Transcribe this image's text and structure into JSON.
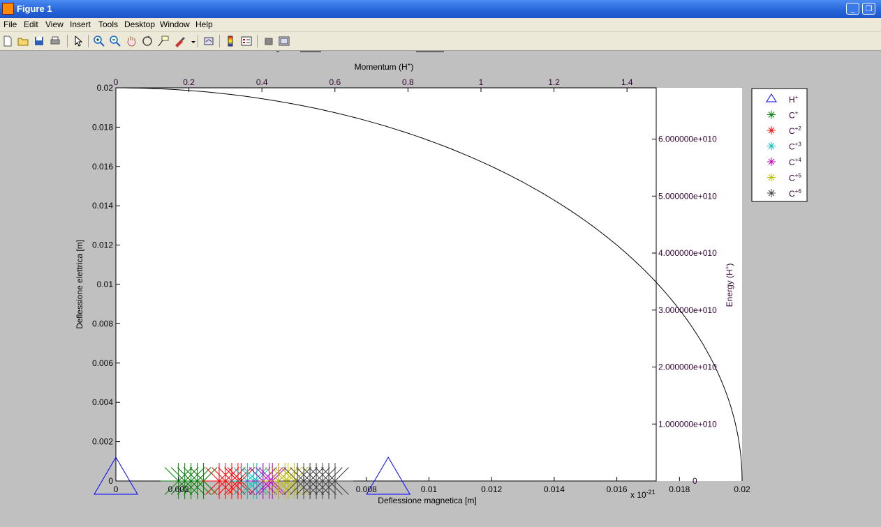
{
  "window": {
    "title": "Figure 1",
    "minimize_glyph": "_",
    "restore_glyph": "❐"
  },
  "menu": [
    "File",
    "Edit",
    "View",
    "Insert",
    "Tools",
    "Desktop",
    "Window",
    "Help"
  ],
  "toolbar_icons": [
    "new-figure-icon",
    "open-file-icon",
    "save-icon",
    "print-icon",
    "pointer-icon",
    "zoom-in-icon",
    "zoom-out-icon",
    "pan-hand-icon",
    "rotate-3d-icon",
    "data-cursor-icon",
    "brush-icon",
    "brush-dropdown-icon",
    "link-plot-icon",
    "colorbar-icon",
    "legend-icon",
    "hide-plot-tools-icon",
    "show-plot-tools-icon"
  ],
  "colors": {
    "hplus": "#0000ff",
    "c1": "#008000",
    "c2": "#ff0000",
    "c3": "#00bfbf",
    "c4": "#bf00bf",
    "c5": "#bfbf00",
    "c6": "#404040",
    "curve": "#000000"
  },
  "plot": {
    "x_label": "Deflessione magnetica [m]",
    "y_label": "Deflessione elettrica [m]",
    "top_label_main": "Momentum (H",
    "top_label_sup": "+",
    "top_label_end": ")",
    "right_label_main": "Energy (H",
    "right_label_sup": "+",
    "right_label_end": ")",
    "top_exponent_base": "x 10",
    "top_exponent_power": "-21",
    "x_ticks": [
      "0",
      "0.002",
      "",
      "",
      "0.008",
      "0.01",
      "0.012",
      "0.014",
      "0.016",
      "0.018",
      "0.02"
    ],
    "y_ticks": [
      "0",
      "0.002",
      "0.004",
      "0.006",
      "0.008",
      "0.01",
      "0.012",
      "0.014",
      "0.016",
      "0.018",
      "0.02"
    ],
    "top_ticks": [
      "0",
      "0.2",
      "0.4",
      "0.6",
      "0.8",
      "1",
      "1.2",
      "1.4"
    ],
    "right_ticks": [
      "0",
      "1.000000e+010",
      "2.000000e+010",
      "3.000000e+010",
      "4.000000e+010",
      "5.000000e+010",
      "6.000000e+010"
    ]
  },
  "chart_data": {
    "type": "scatter",
    "x_range": [
      0,
      0.02
    ],
    "y_range": [
      0,
      0.02
    ],
    "top_axis_range": [
      0,
      1.48
    ],
    "right_axis_range": [
      0,
      69000000000.0
    ],
    "curve": "quarter-ellipse from (0, 0.02) to (0.02, 0)",
    "hplus_points": [
      0,
      0.0087
    ],
    "c_series": [
      {
        "id": "c1",
        "x": [
          0.002,
          0.0022,
          0.0024,
          0.0026,
          0.0028
        ]
      },
      {
        "id": "c2",
        "x": [
          0.0033,
          0.0035,
          0.0037,
          0.0039,
          0.004
        ]
      },
      {
        "id": "c3",
        "x": [
          0.0042,
          0.0044,
          0.0045,
          0.0047
        ]
      },
      {
        "id": "c4",
        "x": [
          0.0047,
          0.0049,
          0.005,
          0.0052
        ]
      },
      {
        "id": "c5",
        "x": [
          0.0052,
          0.0054,
          0.0055,
          0.0057
        ]
      },
      {
        "id": "c6",
        "x": [
          0.0058,
          0.006,
          0.0062,
          0.0064,
          0.0066,
          0.0068,
          0.007
        ]
      }
    ]
  },
  "legend": [
    {
      "id": "hplus",
      "base": "H",
      "sup": "+",
      "marker": "triangle"
    },
    {
      "id": "c1",
      "base": "C",
      "sup": "+",
      "marker": "star"
    },
    {
      "id": "c2",
      "base": "C",
      "sup": "+2",
      "marker": "star"
    },
    {
      "id": "c3",
      "base": "C",
      "sup": "+3",
      "marker": "star"
    },
    {
      "id": "c4",
      "base": "C",
      "sup": "+4",
      "marker": "star"
    },
    {
      "id": "c5",
      "base": "C",
      "sup": "+5",
      "marker": "star"
    },
    {
      "id": "c6",
      "base": "C",
      "sup": "+6",
      "marker": "star"
    }
  ]
}
